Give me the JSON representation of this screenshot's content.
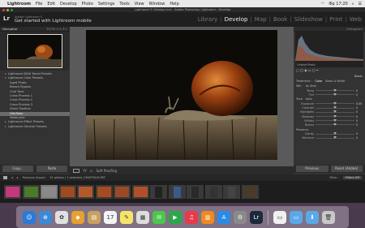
{
  "menubar": {
    "items": [
      "Lightroom",
      "File",
      "Edit",
      "Develop",
      "Photo",
      "Settings",
      "Tools",
      "View",
      "Window",
      "Help"
    ],
    "clock": "Фр 17:20"
  },
  "window": {
    "title": "Lightroom 5 Catalog.lrcat - Adobe Photoshop Lightroom - Develop"
  },
  "identity": {
    "small_text": "Adobe Lightroom 5",
    "get_started": "Get started with Lightroom mobile"
  },
  "modules": [
    "Library",
    "Develop",
    "Map",
    "Book",
    "Slideshow",
    "Print",
    "Web"
  ],
  "active_module": "Develop",
  "left_panel": {
    "navigator_label": "Navigator",
    "navigator_zoom": "Fit  Fill  1:1  3:1",
    "presets": [
      {
        "label": "Lightroom B&W Toned Presets",
        "type": "folder"
      },
      {
        "label": "Lightroom Color Presets",
        "type": "folder"
      },
      {
        "label": "Aged Photo",
        "type": "item"
      },
      {
        "label": "Bleach Bypass",
        "type": "item"
      },
      {
        "label": "Cold Tone",
        "type": "item"
      },
      {
        "label": "Cross Process 1",
        "type": "item"
      },
      {
        "label": "Cross Process 2",
        "type": "item"
      },
      {
        "label": "Cross Process 3",
        "type": "item"
      },
      {
        "label": "Direct Positive",
        "type": "item"
      },
      {
        "label": "Old Polar",
        "type": "item",
        "selected": true
      },
      {
        "label": "Yesteryear",
        "type": "item"
      },
      {
        "label": "Lightroom Effect Presets",
        "type": "folder"
      },
      {
        "label": "Lightroom General Presets",
        "type": "folder"
      }
    ],
    "copy_label": "Copy...",
    "paste_label": "Paste"
  },
  "toolbar": {
    "soft_proofing": "Soft Proofing"
  },
  "right_panel": {
    "histogram_label": "Histogram",
    "original_photo": "Original Photo",
    "basic_label": "Basic",
    "treatment_label": "Treatment :",
    "treatment_color": "Color",
    "treatment_bw": "Black & White",
    "wb_label": "WB :",
    "wb_value": "As Shot",
    "tone_label": "Tone",
    "tone_auto": "Auto",
    "presence_label": "Presence",
    "sliders": [
      {
        "label": "Temp",
        "value": "0",
        "pos": 0.5
      },
      {
        "label": "Tint",
        "value": "0",
        "pos": 0.5
      },
      {
        "label": "Exposure",
        "value": "0.00",
        "pos": 0.5
      },
      {
        "label": "Contrast",
        "value": "0",
        "pos": 0.5
      },
      {
        "label": "Highlights",
        "value": "0",
        "pos": 0.5
      },
      {
        "label": "Shadows",
        "value": "0",
        "pos": 0.5
      },
      {
        "label": "Whites",
        "value": "0",
        "pos": 0.5
      },
      {
        "label": "Blacks",
        "value": "0",
        "pos": 0.5
      },
      {
        "label": "Clarity",
        "value": "0",
        "pos": 0.5
      },
      {
        "label": "Vibrance",
        "value": "0",
        "pos": 0.5
      }
    ],
    "previous_label": "Previous",
    "reset_label": "Reset (Adobe)"
  },
  "filmstrip_bar": {
    "source": "Previous Import",
    "info": "15 photos / 1 selected / IMGP9618.PEF",
    "filter_label": "Filter :",
    "filter_value": "Filters Off"
  },
  "filmstrip": [
    {
      "color": "#c4397a",
      "port": false
    },
    {
      "color": "#4a7a2a",
      "port": false
    },
    {
      "color": "#8a8a8a",
      "port": false
    },
    {
      "color": "#a04a20",
      "port": false
    },
    {
      "color": "#b35a2a",
      "port": false
    },
    {
      "color": "#a54b20",
      "port": false
    },
    {
      "color": "#9a4a25",
      "port": false
    },
    {
      "color": "#b0502a",
      "port": false
    },
    {
      "color": "#222222",
      "port": true
    },
    {
      "color": "#3a5a8a",
      "port": true
    },
    {
      "color": "#2a2a2a",
      "port": true
    },
    {
      "color": "#333333",
      "port": true
    },
    {
      "color": "#444444",
      "port": true
    },
    {
      "color": "#4a3a2a",
      "port": false
    }
  ],
  "dock": [
    {
      "name": "finder-icon",
      "color": "#2a7ad8",
      "glyph": "☺"
    },
    {
      "name": "safari-icon",
      "color": "#3a8ad8",
      "glyph": "⊕"
    },
    {
      "name": "photos-icon",
      "color": "#e0e0e0",
      "glyph": "✿"
    },
    {
      "name": "app-icon",
      "color": "#e8a030",
      "glyph": "◆"
    },
    {
      "name": "notes-icon",
      "color": "#c8a060",
      "glyph": "▤"
    },
    {
      "name": "calendar-icon",
      "color": "#f4f4f4",
      "glyph": "17"
    },
    {
      "name": "notes2-icon",
      "color": "#f6e36a",
      "glyph": "✎"
    },
    {
      "name": "finder2-icon",
      "color": "#dddddd",
      "glyph": "▦"
    },
    {
      "name": "messages-icon",
      "color": "#4ac84a",
      "glyph": "✉"
    },
    {
      "name": "facetime-icon",
      "color": "#2aa84a",
      "glyph": "▶"
    },
    {
      "name": "music-icon",
      "color": "#e83a4a",
      "glyph": "♫"
    },
    {
      "name": "books-icon",
      "color": "#f08a20",
      "glyph": "▥"
    },
    {
      "name": "appstore-icon",
      "color": "#2a8ae8",
      "glyph": "A"
    },
    {
      "name": "settings-icon",
      "color": "#8a8a8a",
      "glyph": "⚙"
    },
    {
      "name": "lightroom-icon",
      "color": "#1a2a3a",
      "glyph": "Lr"
    },
    {
      "name": "folder-icon",
      "color": "#f0f0f0",
      "glyph": "▭"
    },
    {
      "name": "folder-blue-icon",
      "color": "#5aa8e8",
      "glyph": "▭"
    },
    {
      "name": "downloads-icon",
      "color": "#5aa8e8",
      "glyph": "⬇"
    },
    {
      "name": "trash-icon",
      "color": "#c8c8c8",
      "glyph": "🗑"
    }
  ]
}
